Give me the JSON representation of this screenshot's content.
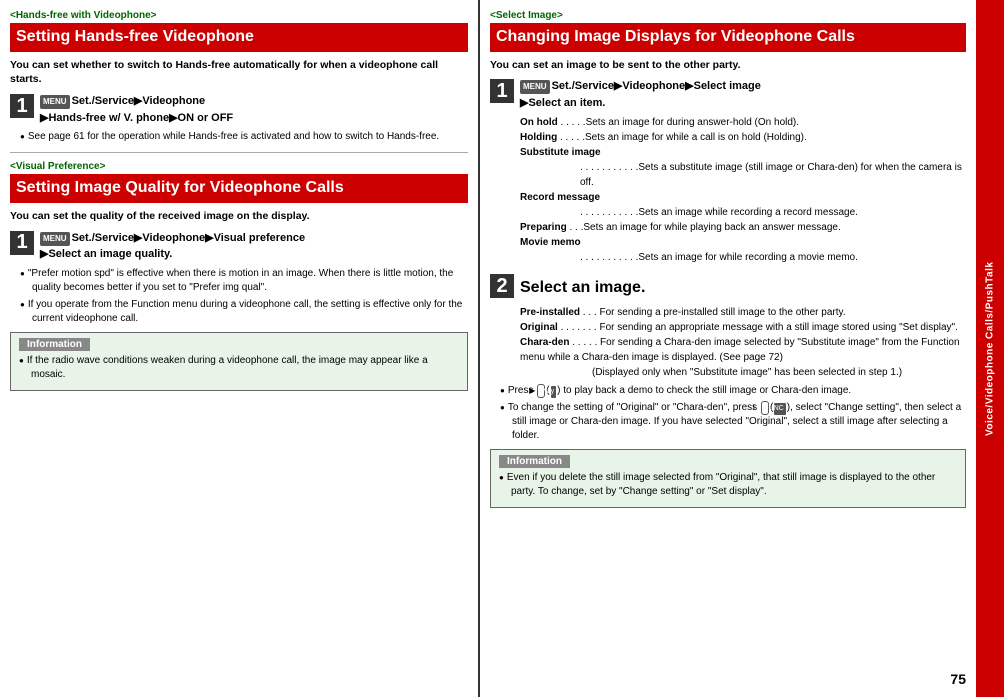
{
  "left": {
    "section1": {
      "tag": "<Hands-free with Videophone>",
      "title": "Setting Hands-free Videophone",
      "desc": "You can set whether to switch to Hands-free automatically for when a videophone call starts.",
      "step1": {
        "num": "1",
        "menu": "MENU",
        "text1": "Set./Service",
        "arrow": "▶",
        "text2": "Videophone",
        "arrow2": "▶",
        "text3": "Hands-free w/ V. phone",
        "arrow3": "▶",
        "text4": "ON or OFF"
      },
      "bullets": [
        "See page 61 for the operation while Hands-free is activated and how to switch to Hands-free."
      ]
    },
    "section2": {
      "tag": "<Visual Preference>",
      "title": "Setting Image Quality for Videophone Calls",
      "desc": "You can set the quality of the received image on the display.",
      "step1": {
        "num": "1",
        "menu": "MENU",
        "text1": "Set./Service",
        "arrow": "▶",
        "text2": "Videophone",
        "arrow2": "▶",
        "text3": "Visual preference",
        "arrow3": "▶",
        "text4": "Select an image quality."
      },
      "bullets": [
        "\"Prefer motion spd\" is effective when there is motion in an image. When there is little motion, the quality becomes better if you set to \"Prefer img qual\".",
        "If you operate from the Function menu during a videophone call, the setting is effective only for the current videophone call."
      ],
      "infobox": {
        "title": "Information",
        "bullets": [
          "If the radio wave conditions weaken during a videophone call, the image may appear like a mosaic."
        ]
      }
    }
  },
  "right": {
    "section1": {
      "tag": "<Select Image>",
      "title": "Changing Image Displays for Videophone Calls",
      "desc": "You can set an image to be sent to the other party.",
      "step1": {
        "num": "1",
        "menu": "MENU",
        "text1": "Set./Service",
        "arrow": "▶",
        "text2": "Videophone",
        "arrow2": "▶",
        "text3": "Select image",
        "arrow3": "▶",
        "text4": "Select an item."
      },
      "details": [
        {
          "label": "On hold",
          "dots": ". . . . .",
          "text": "Sets an image for during answer-hold (On hold)."
        },
        {
          "label": "Holding",
          "dots": " . . . . .",
          "text": "Sets an image for while a call is on hold (Holding)."
        },
        {
          "label": "Substitute image",
          "dots": "",
          "text": ""
        },
        {
          "label": "",
          "dots": ". . . . . . . . . . .",
          "text": "Sets a substitute image (still image or Chara-den) for when the camera is off."
        },
        {
          "label": "Record message",
          "dots": "",
          "text": ""
        },
        {
          "label": "",
          "dots": ". . . . . . . . . . .",
          "text": "Sets an image while recording a record message."
        },
        {
          "label": "Preparing",
          "dots": " . . .",
          "text": "Sets an image for while playing back an answer message."
        },
        {
          "label": "Movie memo",
          "dots": "",
          "text": ""
        },
        {
          "label": "",
          "dots": ". . . . . . . . . . .",
          "text": "Sets an image for while recording a movie memo."
        }
      ]
    },
    "step2": {
      "num": "2",
      "title": "Select an image.",
      "items": [
        {
          "label": "Pre-installed",
          "dots": ". . .",
          "text": "For sending a pre-installed still image to the other party."
        },
        {
          "label": "Original",
          "dots": " . . . . . . .",
          "text": "For sending an appropriate message with a still image stored using \"Set display\"."
        },
        {
          "label": "Chara-den",
          "dots": " . . . . .",
          "text": "For sending a Chara-den image selected by \"Substitute image\" from the Function menu while a Chara-den image is displayed. (See page 72)\n(Displayed only when \"Substitute image\" has been selected in step 1.)"
        }
      ],
      "bullets": [
        "Press  (      ) to play back a demo to check the still image or Chara-den image.",
        "To change the setting of \"Original\" or \"Chara-den\", press   (      ), select \"Change setting\", then select a still image or Chara-den image. If you have selected \"Original\", select a still image after selecting a folder."
      ],
      "infobox": {
        "title": "Information",
        "bullets": [
          "Even if you delete the still image selected from \"Original\", that still image is displayed to the other party. To change, set by \"Change setting\" or \"Set display\"."
        ]
      }
    }
  },
  "sidetab": {
    "label": "Voice/Videophone Calls/PushTalk"
  },
  "pagenum": "75"
}
